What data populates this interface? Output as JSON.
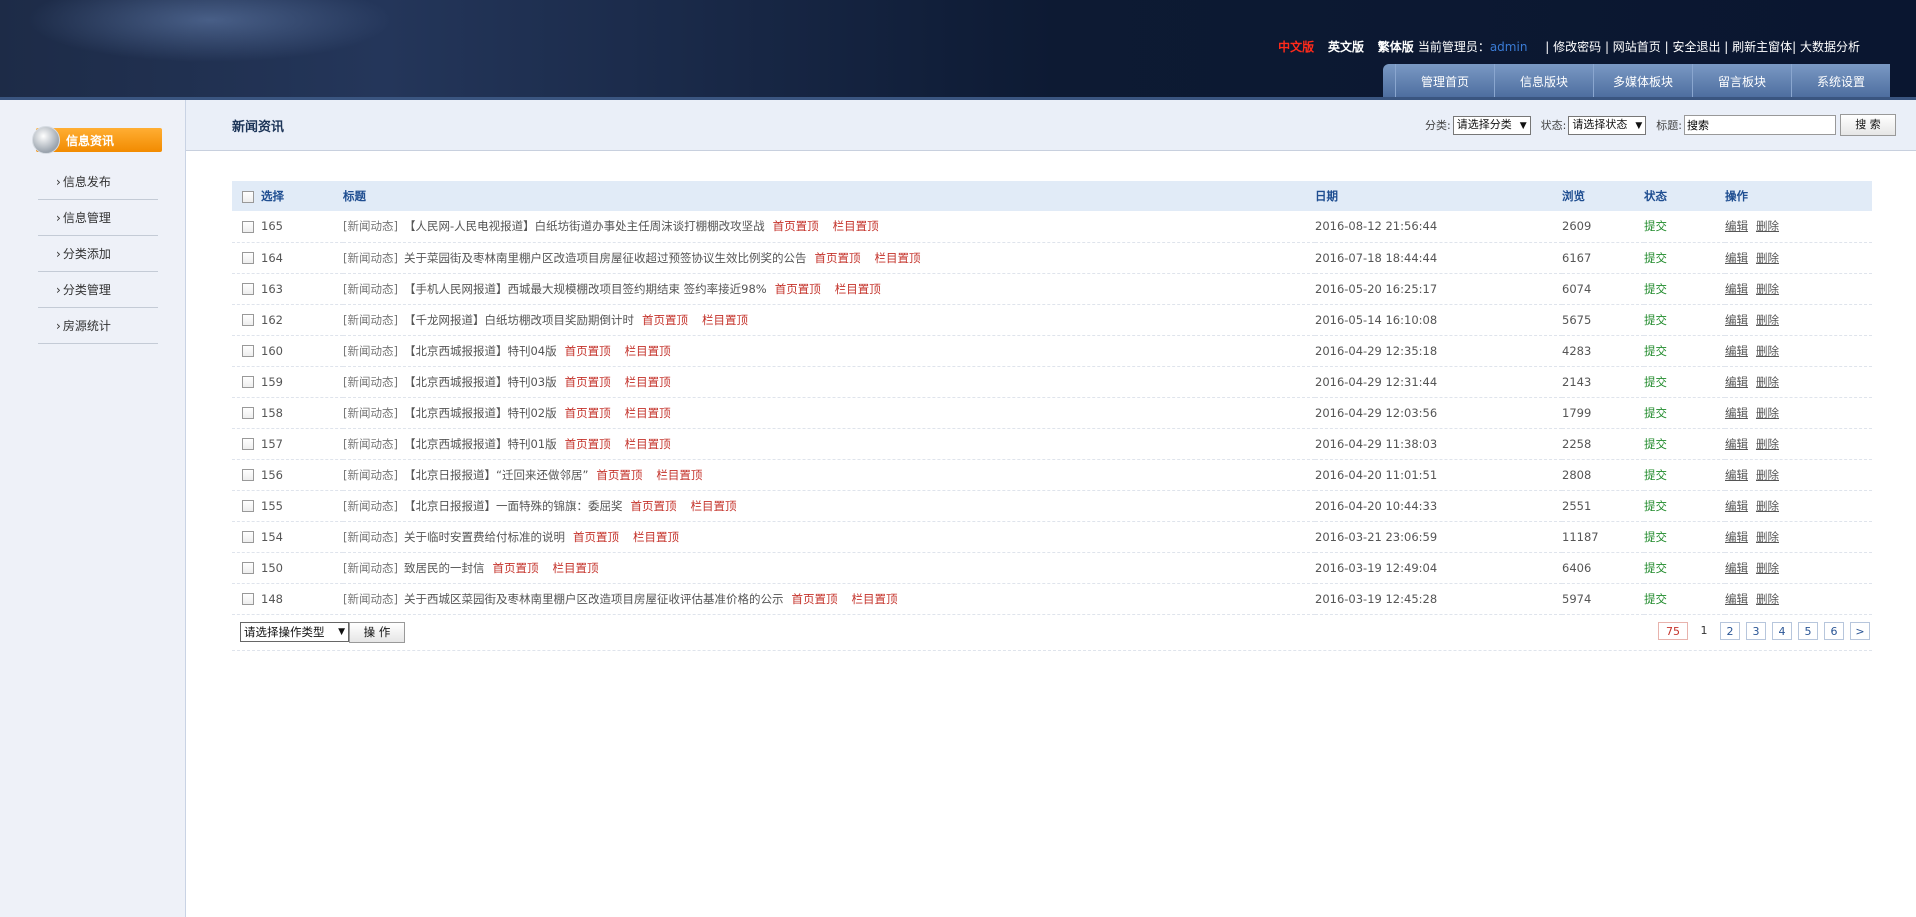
{
  "header": {
    "lang_cn": "中文版",
    "lang_en": "英文版",
    "lang_tw": "繁体版",
    "admin_label": "当前管理员：",
    "admin_name": "admin",
    "links": "| 修改密码 | 网站首页 | 安全退出 | 刷新主窗体| 大数据分析",
    "nav": [
      "管理首页",
      "信息版块",
      "多媒体板块",
      "留言板块",
      "系统设置"
    ]
  },
  "sidebar": {
    "section_title": "信息资讯",
    "items": [
      "信息发布",
      "信息管理",
      "分类添加",
      "分类管理",
      "房源统计"
    ]
  },
  "toolbar": {
    "title": "新闻资讯",
    "category_label": "分类:",
    "category_value": "请选择分类",
    "status_label": "状态:",
    "status_value": "请选择状态",
    "keyword_label": "标题:",
    "keyword_value": "搜索",
    "search_button": "搜 索"
  },
  "table": {
    "headers": [
      "选择",
      "标题",
      "日期",
      "浏览",
      "状态",
      "操作"
    ],
    "pin_home": "首页置顶",
    "pin_column": "栏目置顶",
    "edit": "编辑",
    "delete": "删除",
    "rows": [
      {
        "id": "165",
        "category": "[新闻动态]",
        "title": "【人民网-人民电视报道】白纸坊街道办事处主任周沫谈打棚棚改攻坚战",
        "date": "2016-08-12 21:56:44",
        "views": "2609",
        "status": "提交"
      },
      {
        "id": "164",
        "category": "[新闻动态]",
        "title": "关于菜园街及枣林南里棚户区改造项目房屋征收超过预签协议生效比例奖的公告",
        "date": "2016-07-18 18:44:44",
        "views": "6167",
        "status": "提交"
      },
      {
        "id": "163",
        "category": "[新闻动态]",
        "title": "【手机人民网报道】西城最大规模棚改项目签约期结束 签约率接近98%",
        "date": "2016-05-20 16:25:17",
        "views": "6074",
        "status": "提交"
      },
      {
        "id": "162",
        "category": "[新闻动态]",
        "title": "【千龙网报道】白纸坊棚改项目奖励期倒计时",
        "date": "2016-05-14 16:10:08",
        "views": "5675",
        "status": "提交"
      },
      {
        "id": "160",
        "category": "[新闻动态]",
        "title": "【北京西城报报道】特刊04版",
        "date": "2016-04-29 12:35:18",
        "views": "4283",
        "status": "提交"
      },
      {
        "id": "159",
        "category": "[新闻动态]",
        "title": "【北京西城报报道】特刊03版",
        "date": "2016-04-29 12:31:44",
        "views": "2143",
        "status": "提交"
      },
      {
        "id": "158",
        "category": "[新闻动态]",
        "title": "【北京西城报报道】特刊02版",
        "date": "2016-04-29 12:03:56",
        "views": "1799",
        "status": "提交"
      },
      {
        "id": "157",
        "category": "[新闻动态]",
        "title": "【北京西城报报道】特刊01版",
        "date": "2016-04-29 11:38:03",
        "views": "2258",
        "status": "提交"
      },
      {
        "id": "156",
        "category": "[新闻动态]",
        "title": "【北京日报报道】“迁回来还做邻居”",
        "date": "2016-04-20 11:01:51",
        "views": "2808",
        "status": "提交"
      },
      {
        "id": "155",
        "category": "[新闻动态]",
        "title": "【北京日报报道】一面特殊的锦旗：委屈奖",
        "date": "2016-04-20 10:44:33",
        "views": "2551",
        "status": "提交"
      },
      {
        "id": "154",
        "category": "[新闻动态]",
        "title": "关于临时安置费给付标准的说明",
        "date": "2016-03-21 23:06:59",
        "views": "11187",
        "status": "提交"
      },
      {
        "id": "150",
        "category": "[新闻动态]",
        "title": "致居民的一封信",
        "date": "2016-03-19 12:49:04",
        "views": "6406",
        "status": "提交"
      },
      {
        "id": "148",
        "category": "[新闻动态]",
        "title": "关于西城区菜园街及枣林南里棚户区改造项目房屋征收评估基准价格的公示",
        "date": "2016-03-19 12:45:28",
        "views": "5974",
        "status": "提交"
      }
    ]
  },
  "batch": {
    "select_value": "请选择操作类型",
    "button": "操 作"
  },
  "pager": {
    "total": "75",
    "current": "1",
    "pages": [
      "2",
      "3",
      "4",
      "5",
      "6"
    ],
    "next": ">"
  }
}
